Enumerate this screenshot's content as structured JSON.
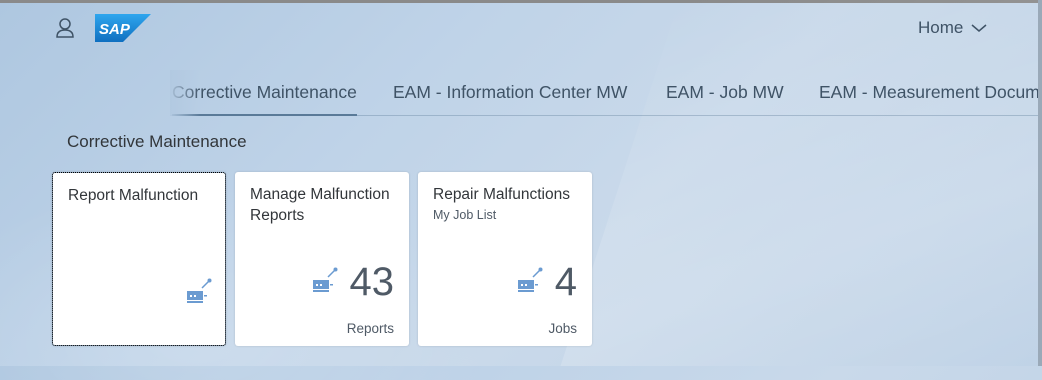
{
  "header": {
    "home_label": "Home",
    "logo_text": "SAP",
    "brand_color": "#1a8ad8"
  },
  "tabs": [
    {
      "label": "Corrective Maintenance",
      "active": true
    },
    {
      "label": "EAM - Information Center MW",
      "active": false
    },
    {
      "label": "EAM - Job MW",
      "active": false
    },
    {
      "label": "EAM - Measurement Documents"
    }
  ],
  "group": {
    "title": "Corrective Maintenance",
    "tiles": [
      {
        "title": "Report Malfunction",
        "subtitle": "",
        "icon": "malfunction-icon",
        "number": "",
        "unit": ""
      },
      {
        "title": "Manage Malfunction Reports",
        "subtitle": "",
        "icon": "malfunction-icon",
        "number": "43",
        "unit": "Reports"
      },
      {
        "title": "Repair Malfunctions",
        "subtitle": "My Job List",
        "icon": "malfunction-icon",
        "number": "4",
        "unit": "Jobs"
      }
    ]
  }
}
